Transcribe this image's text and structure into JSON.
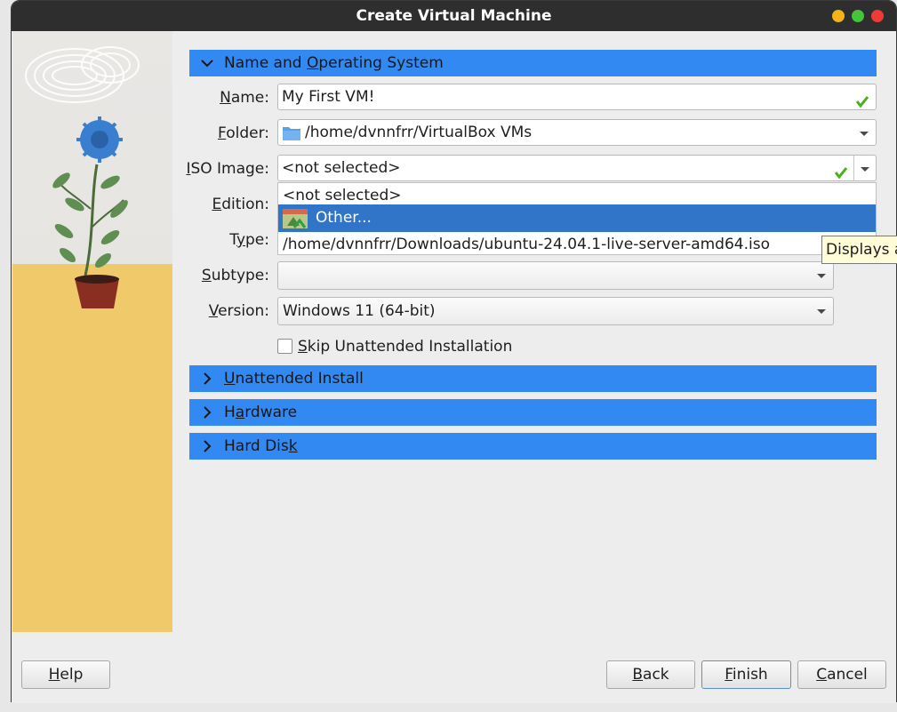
{
  "window": {
    "title": "Create Virtual Machine"
  },
  "sections": {
    "name_os": {
      "label_pre": "Name and ",
      "label_u": "O",
      "label_post": "perating System",
      "expanded": true
    },
    "unattended": {
      "label_u": "U",
      "label_post": "nattended Install",
      "expanded": false
    },
    "hardware": {
      "label_pre": "H",
      "label_u": "a",
      "label_post": "rdware",
      "expanded": false
    },
    "hard_disk": {
      "label_pre": "Hard Dis",
      "label_u": "k",
      "expanded": false
    }
  },
  "fields": {
    "name": {
      "label_u": "N",
      "label_post": "ame:",
      "value": "My First VM!",
      "valid": true
    },
    "folder": {
      "label_u": "F",
      "label_post": "older:",
      "value": "/home/dvnnfrr/VirtualBox VMs"
    },
    "iso": {
      "label_u": "I",
      "label_post": "SO Image:",
      "value": "<not selected>",
      "valid": true
    },
    "edition": {
      "label_u": "E",
      "label_post": "dition:"
    },
    "type": {
      "label_pre": "T",
      "label_u": "y",
      "label_post": "pe:"
    },
    "subtype": {
      "label_u": "S",
      "label_post": "ubtype:",
      "value": ""
    },
    "version": {
      "label_u": "V",
      "label_post": "ersion:",
      "value": "Windows 11 (64-bit)"
    },
    "skip_unattended": {
      "label_u": "S",
      "label_post": "kip Unattended Installation",
      "checked": false
    }
  },
  "iso_dropdown": {
    "items": [
      "<not selected>",
      "Other...",
      "/home/dvnnfrr/Downloads/ubuntu-24.04.1-live-server-amd64.iso"
    ],
    "highlighted_index": 1
  },
  "tooltip": {
    "text": "Displays a"
  },
  "buttons": {
    "help": {
      "label_u": "H",
      "label_post": "elp"
    },
    "back": {
      "label_u": "B",
      "label_post": "ack"
    },
    "finish": {
      "label_u": "F",
      "label_post": "inish"
    },
    "cancel": {
      "label_u": "C",
      "label_post": "ancel"
    }
  },
  "colors": {
    "section_header": "#3389f2",
    "selection": "#3075c7",
    "titlebar": "#2e2e2e",
    "check": "#4caf1e"
  },
  "icons": [
    "chevron-down-icon",
    "chevron-right-icon",
    "checkmark-icon",
    "folder-icon",
    "dropdown-arrow-icon",
    "iso-image-icon"
  ]
}
